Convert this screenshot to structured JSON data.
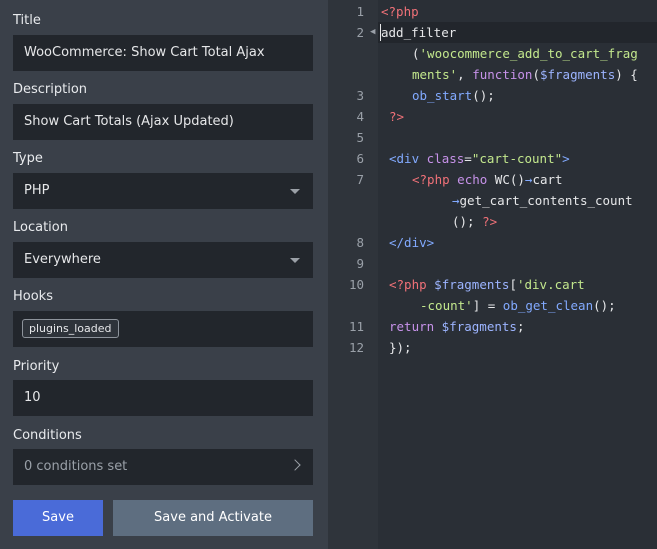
{
  "form": {
    "title_label": "Title",
    "title_value": "WooCommerce: Show Cart Total Ajax",
    "description_label": "Description",
    "description_value": "Show Cart Totals (Ajax Updated)",
    "type_label": "Type",
    "type_value": "PHP",
    "location_label": "Location",
    "location_value": "Everywhere",
    "hooks_label": "Hooks",
    "hook_tag": "plugins_loaded",
    "priority_label": "Priority",
    "priority_value": "10",
    "conditions_label": "Conditions",
    "conditions_value": "0 conditions set",
    "save_label": "Save",
    "save_activate_label": "Save and Activate"
  },
  "editor": {
    "line_numbers": [
      "1",
      "2",
      "3",
      "4",
      "5",
      "6",
      "7",
      "8",
      "9",
      "10",
      "11",
      "12"
    ],
    "lines": {
      "l1": "<?php",
      "l2": "add_filter",
      "l2b_a": "(",
      "l2b_str": "'woocommerce_add_to_cart_frag",
      "l2c_str": "ments'",
      "l2c_b": ", ",
      "l2c_kw": "function",
      "l2c_c": "(",
      "l2c_var": "$fragments",
      "l2c_d": ") {",
      "l3_fn": "ob_start",
      "l3_b": "();",
      "l4": "?>",
      "l6_a": "<div ",
      "l6_attr": "class",
      "l6_eq": "=",
      "l6_str": "\"cart-count\"",
      "l6_b": ">",
      "l7_php": "<?php",
      "l7_kw": " echo ",
      "l7_fn": "WC",
      "l7_b": "()",
      "l7_arrow": "→",
      "l7_c": "cart",
      "l7b_arrow": "→",
      "l7b_fn": "get_cart_contents_count",
      "l7c_a": "(); ",
      "l7c_php": "?>",
      "l8": "</div>",
      "l10_php": "<?php",
      "l10_var": " $fragments",
      "l10_a": "[",
      "l10_str": "'div.cart",
      "l10b_str": "-count'",
      "l10b_a": "] = ",
      "l10b_fn": "ob_get_clean",
      "l10b_b": "();",
      "l11_kw": "return",
      "l11_var": " $fragments",
      "l11_a": ";",
      "l12": "});"
    }
  },
  "colors": {
    "accent": "#4a6bd8",
    "secondary_button": "#5e6e80"
  }
}
